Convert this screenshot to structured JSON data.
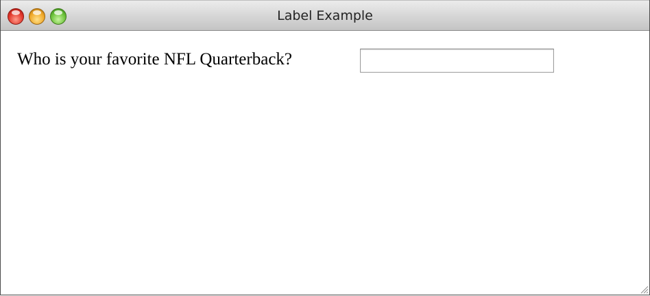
{
  "window": {
    "title": "Label Example"
  },
  "form": {
    "question_label": "Who is your favorite NFL Quarterback?",
    "answer_value": "",
    "answer_placeholder": ""
  },
  "icons": {
    "close": "close-button",
    "minimize": "minimize-button",
    "zoom": "zoom-button",
    "resize": "resize-grip-icon"
  },
  "colors": {
    "close": "#e2362a",
    "minimize": "#f0a92a",
    "zoom": "#6cc23a"
  }
}
